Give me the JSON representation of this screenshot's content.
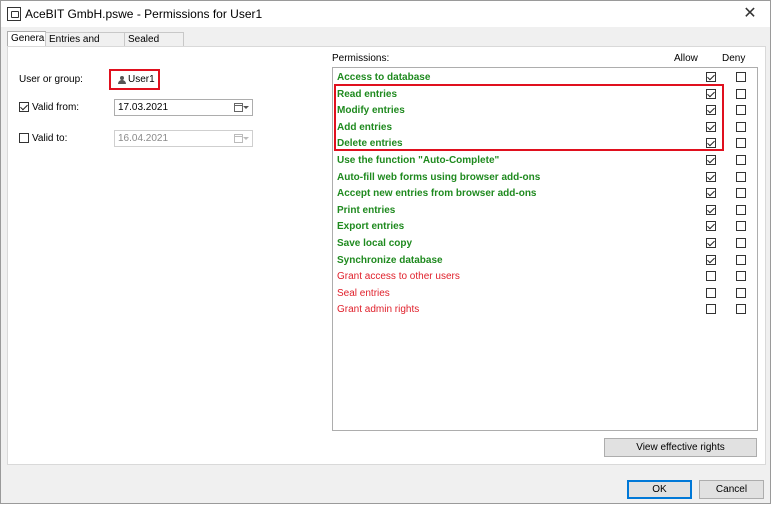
{
  "window": {
    "title": "AceBIT GmbH.pswe - Permissions for User1"
  },
  "tabs": [
    {
      "label": "General",
      "active": true
    },
    {
      "label": "Entries and folders",
      "active": false
    },
    {
      "label": "Sealed access",
      "active": false
    }
  ],
  "general": {
    "user_label": "User or group:",
    "user_value": "User1",
    "valid_from_label": "Valid from:",
    "valid_from_checked": true,
    "valid_from_value": "17.03.2021",
    "valid_to_label": "Valid to:",
    "valid_to_checked": false,
    "valid_to_value": "16.04.2021"
  },
  "permissions": {
    "header": "Permissions:",
    "allow_header": "Allow",
    "deny_header": "Deny",
    "items": [
      {
        "label": "Access to database",
        "allow": true,
        "deny": false,
        "color": "green"
      },
      {
        "label": "Read entries",
        "allow": true,
        "deny": false,
        "color": "green"
      },
      {
        "label": "Modify entries",
        "allow": true,
        "deny": false,
        "color": "green"
      },
      {
        "label": "Add entries",
        "allow": true,
        "deny": false,
        "color": "green"
      },
      {
        "label": "Delete entries",
        "allow": true,
        "deny": false,
        "color": "green"
      },
      {
        "label": "Use the function \"Auto-Complete\"",
        "allow": true,
        "deny": false,
        "color": "green"
      },
      {
        "label": "Auto-fill web forms using browser add-ons",
        "allow": true,
        "deny": false,
        "color": "green"
      },
      {
        "label": "Accept new entries from browser add-ons",
        "allow": true,
        "deny": false,
        "color": "green"
      },
      {
        "label": "Print entries",
        "allow": true,
        "deny": false,
        "color": "green"
      },
      {
        "label": "Export entries",
        "allow": true,
        "deny": false,
        "color": "green"
      },
      {
        "label": "Save local copy",
        "allow": true,
        "deny": false,
        "color": "green"
      },
      {
        "label": "Synchronize database",
        "allow": true,
        "deny": false,
        "color": "green"
      },
      {
        "label": "Grant access to other users",
        "allow": false,
        "deny": false,
        "color": "red"
      },
      {
        "label": "Seal entries",
        "allow": false,
        "deny": false,
        "color": "red"
      },
      {
        "label": "Grant admin rights",
        "allow": false,
        "deny": false,
        "color": "red"
      }
    ]
  },
  "buttons": {
    "view_rights": "View effective rights",
    "ok": "OK",
    "cancel": "Cancel"
  },
  "colors": {
    "granted_text": "#1f8a1f",
    "restricted_text": "#e0202b",
    "highlight_border": "#e0101e",
    "default_button_border": "#0078d7"
  }
}
